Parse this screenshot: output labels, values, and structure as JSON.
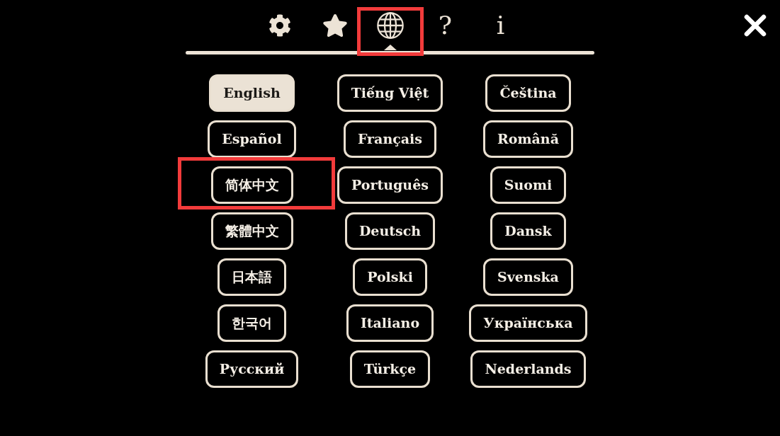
{
  "tabs": [
    {
      "kind": "settings",
      "selected": false,
      "highlighted": false
    },
    {
      "kind": "favorites",
      "selected": false,
      "highlighted": false
    },
    {
      "kind": "language",
      "selected": true,
      "highlighted": true
    },
    {
      "kind": "help",
      "label": "?",
      "selected": false,
      "highlighted": false
    },
    {
      "kind": "info",
      "label": "i",
      "selected": false,
      "highlighted": false
    }
  ],
  "language_grid": {
    "columns": [
      {
        "items": [
          {
            "label": "English",
            "selected": true,
            "highlighted": false
          },
          {
            "label": "Español",
            "selected": false,
            "highlighted": false
          },
          {
            "label": "简体中文",
            "selected": false,
            "highlighted": true
          },
          {
            "label": "繁體中文",
            "selected": false,
            "highlighted": false
          },
          {
            "label": "日本語",
            "selected": false,
            "highlighted": false
          },
          {
            "label": "한국어",
            "selected": false,
            "highlighted": false
          },
          {
            "label": "Русский",
            "selected": false,
            "highlighted": false
          }
        ]
      },
      {
        "items": [
          {
            "label": "Tiếng Việt",
            "selected": false,
            "highlighted": false
          },
          {
            "label": "Français",
            "selected": false,
            "highlighted": false
          },
          {
            "label": "Português",
            "selected": false,
            "highlighted": false
          },
          {
            "label": "Deutsch",
            "selected": false,
            "highlighted": false
          },
          {
            "label": "Polski",
            "selected": false,
            "highlighted": false
          },
          {
            "label": "Italiano",
            "selected": false,
            "highlighted": false
          },
          {
            "label": "Türkçe",
            "selected": false,
            "highlighted": false
          }
        ]
      },
      {
        "items": [
          {
            "label": "Čeština",
            "selected": false,
            "highlighted": false
          },
          {
            "label": "Română",
            "selected": false,
            "highlighted": false
          },
          {
            "label": "Suomi",
            "selected": false,
            "highlighted": false
          },
          {
            "label": "Dansk",
            "selected": false,
            "highlighted": false
          },
          {
            "label": "Svenska",
            "selected": false,
            "highlighted": false
          },
          {
            "label": "Українська",
            "selected": false,
            "highlighted": false
          },
          {
            "label": "Nederlands",
            "selected": false,
            "highlighted": false
          }
        ]
      }
    ]
  }
}
